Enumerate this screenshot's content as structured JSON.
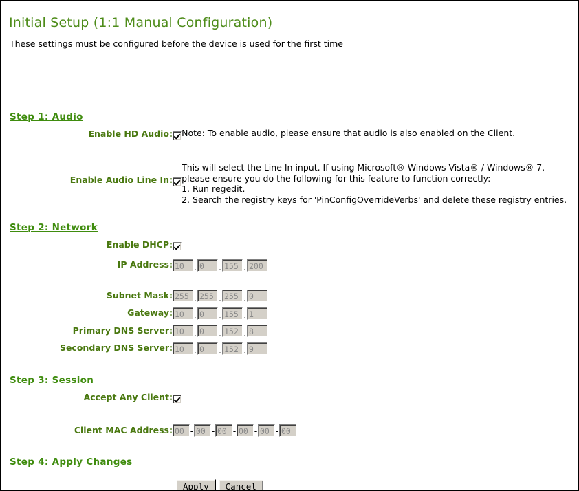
{
  "header": {
    "title": "Initial Setup (1:1 Manual Configuration)",
    "subtitle": "These settings must be configured before the device is used for the first time"
  },
  "steps": {
    "audio": {
      "heading": "Step 1: Audio",
      "fields": {
        "hd_audio_label": "Enable HD Audio:",
        "hd_audio_checked": true,
        "hd_audio_note": "Note: To enable audio, please ensure that audio is also enabled on the Client.",
        "line_in_label": "Enable Audio Line In:",
        "line_in_checked": true,
        "line_in_note_1": "This will select the Line In input. If using Microsoft® Windows Vista® / Windows® 7,",
        "line_in_note_2": "please ensure you do the following for this feature to function correctly:",
        "line_in_note_3": "1. Run regedit.",
        "line_in_note_4": "2. Search the registry keys for 'PinConfigOverrideVerbs' and delete these registry entries."
      }
    },
    "network": {
      "heading": "Step 2: Network",
      "dhcp_label": "Enable DHCP:",
      "dhcp_checked": true,
      "separator_dot": ".",
      "rows": [
        {
          "label": "IP Address:",
          "octets": [
            "10",
            "0",
            "155",
            "200"
          ]
        },
        {
          "label": "Subnet Mask:",
          "octets": [
            "255",
            "255",
            "255",
            "0"
          ]
        },
        {
          "label": "Gateway:",
          "octets": [
            "10",
            "0",
            "155",
            "1"
          ]
        },
        {
          "label": "Primary DNS Server:",
          "octets": [
            "10",
            "0",
            "152",
            "8"
          ]
        },
        {
          "label": "Secondary DNS Server:",
          "octets": [
            "10",
            "0",
            "152",
            "9"
          ]
        }
      ]
    },
    "session": {
      "heading": "Step 3: Session",
      "accept_any_label": "Accept Any Client:",
      "accept_any_checked": true,
      "mac_label": "Client MAC Address:",
      "mac_separator": "-",
      "mac_octets": [
        "00",
        "00",
        "00",
        "00",
        "00",
        "00"
      ]
    },
    "apply": {
      "heading": "Step 4: Apply Changes",
      "apply_label": "Apply",
      "cancel_label": "Cancel"
    }
  },
  "colors": {
    "title_green": "#4e8c1a",
    "heading_green": "#3f8c0e",
    "label_green": "#49780f",
    "field_bg": "#d4d0c8",
    "field_text": "#8a8a8a"
  }
}
